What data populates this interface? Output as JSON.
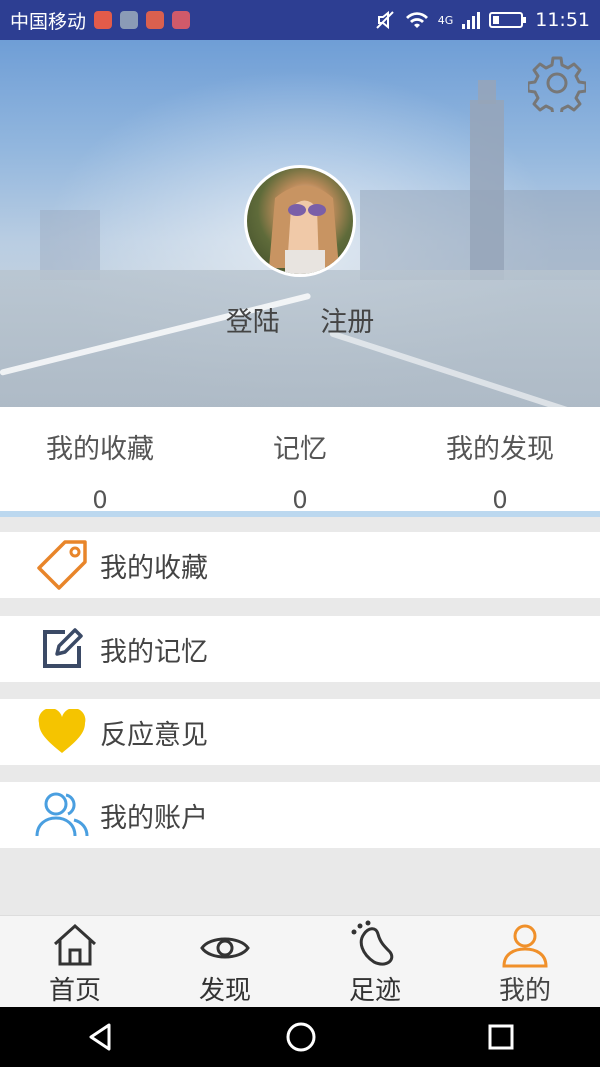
{
  "status_bar": {
    "carrier": "中国移动",
    "network": "4G",
    "time": "11:51"
  },
  "profile": {
    "login_label": "登陆",
    "register_label": "注册"
  },
  "stats": [
    {
      "label": "我的收藏",
      "value": "0"
    },
    {
      "label": "记忆",
      "value": "0"
    },
    {
      "label": "我的发现",
      "value": "0"
    }
  ],
  "menu": [
    {
      "label": "我的收藏",
      "icon": "tag-icon"
    },
    {
      "label": "我的记忆",
      "icon": "edit-icon"
    },
    {
      "label": "反应意见",
      "icon": "heart-icon"
    },
    {
      "label": "我的账户",
      "icon": "users-icon"
    }
  ],
  "tabs": [
    {
      "label": "首页",
      "icon": "home-icon"
    },
    {
      "label": "发现",
      "icon": "eye-icon"
    },
    {
      "label": "足迹",
      "icon": "footprint-icon"
    },
    {
      "label": "我的",
      "icon": "user-icon",
      "active": true
    }
  ],
  "colors": {
    "status_bar": "#2d3e92",
    "tag": "#e8852a",
    "edit": "#3b4a66",
    "heart": "#f5c400",
    "users": "#4a9fe0",
    "active_tab": "#f0902a"
  }
}
